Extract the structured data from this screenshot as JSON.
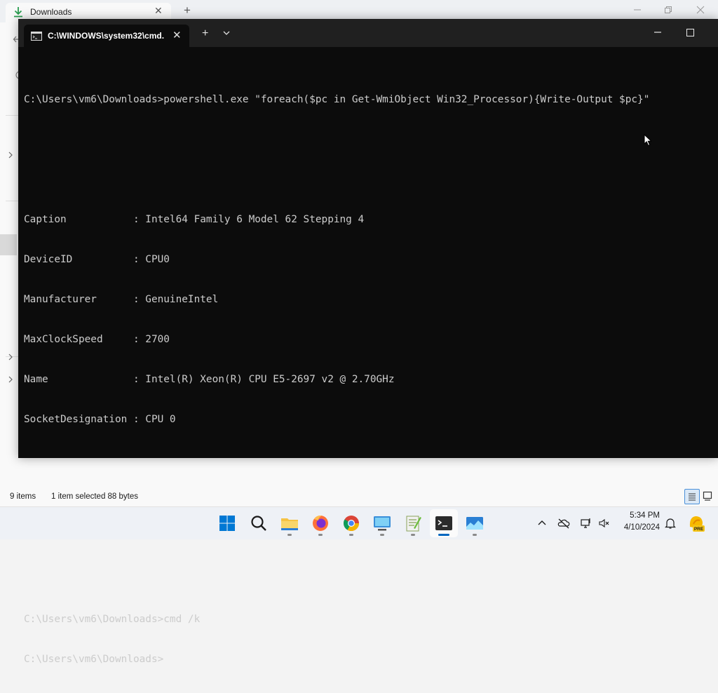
{
  "explorer": {
    "tab_title": "Downloads",
    "tab_close": "✕",
    "new_tab": "+",
    "status_items": "9 items",
    "status_selected": "1 item selected  88 bytes"
  },
  "terminal": {
    "tab_title": "C:\\WINDOWS\\system32\\cmd.",
    "tab_close": "✕",
    "new_tab": "+",
    "lines": [
      "C:\\Users\\vm6\\Downloads>powershell.exe \"foreach($pc in Get-WmiObject Win32_Processor){Write-Output $pc}\"",
      "",
      "",
      "Caption           : Intel64 Family 6 Model 62 Stepping 4",
      "DeviceID          : CPU0",
      "Manufacturer      : GenuineIntel",
      "MaxClockSpeed     : 2700",
      "Name              : Intel(R) Xeon(R) CPU E5-2697 v2 @ 2.70GHz",
      "SocketDesignation : CPU 0",
      "",
      "",
      "",
      "",
      "C:\\Users\\vm6\\Downloads>cmd /k",
      "C:\\Users\\vm6\\Downloads>"
    ]
  },
  "taskbar": {
    "apps": [
      "start-icon",
      "search-icon",
      "file-explorer-icon",
      "firefox-icon",
      "chrome-icon",
      "remote-desktop-icon",
      "notepad-plus-plus-icon",
      "terminal-icon",
      "photos-icon"
    ],
    "tray_icons": [
      "chevron-up-icon",
      "onedrive-icon",
      "network-icon",
      "volume-muted-icon",
      "bell-icon"
    ],
    "time": "5:34 PM",
    "date": "4/10/2024",
    "badge_text": "PRE"
  },
  "colors": {
    "terminal_bg": "#0c0c0c",
    "terminal_text": "#cccccc",
    "accent": "#0067c0"
  }
}
